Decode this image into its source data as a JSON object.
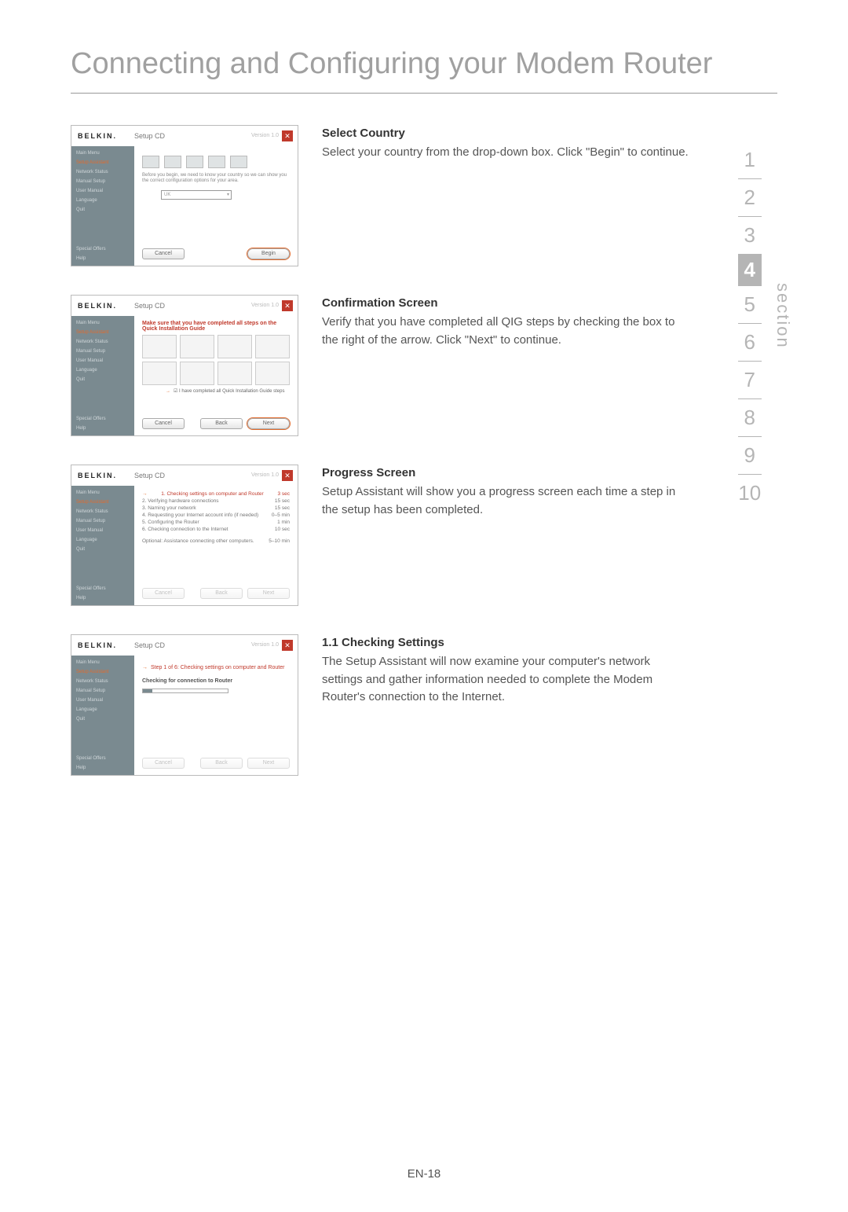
{
  "page_title": "Connecting and Configuring your Modem Router",
  "page_number": "EN-18",
  "nav": {
    "label": "section",
    "items": [
      "1",
      "2",
      "3",
      "4",
      "5",
      "6",
      "7",
      "8",
      "9",
      "10"
    ],
    "active": "4"
  },
  "shot_common": {
    "logo": "BELKIN.",
    "title": "Setup CD",
    "version": "Version 1.0",
    "close": "✕",
    "menu": {
      "main": "Main Menu",
      "setup": "Setup Assistant",
      "status": "Network Status",
      "manual": "Manual Setup",
      "user_manual": "User Manual",
      "language": "Language",
      "quit": "Quit",
      "offers": "Special Offers",
      "help": "Help"
    }
  },
  "sec1": {
    "heading": "Select Country",
    "body": "Select your country from the drop-down box. Click \"Begin\" to continue.",
    "hint": "Before you begin, we need to know your country so we can show you the correct configuration options for your area.",
    "dropdown": "UK",
    "cancel": "Cancel",
    "begin": "Begin"
  },
  "sec2": {
    "heading": "Confirmation Screen",
    "body": "Verify that you have completed all QIG steps by checking the box to the right of the arrow. Click \"Next\" to continue.",
    "banner": "Make sure that you have completed all steps on the Quick Installation Guide",
    "check": "I have completed all Quick Installation Guide steps",
    "cancel": "Cancel",
    "back": "Back",
    "next": "Next"
  },
  "sec3": {
    "heading": "Progress Screen",
    "body": "Setup Assistant will show you a progress screen each time a step in the setup has been completed.",
    "rows": [
      {
        "t": "1. Checking settings on computer and Router",
        "d": "3 sec"
      },
      {
        "t": "2. Verifying hardware connections",
        "d": "15 sec"
      },
      {
        "t": "3. Naming your network",
        "d": "15 sec"
      },
      {
        "t": "4. Requesting your Internet account info (if needed)",
        "d": "0–5 min"
      },
      {
        "t": "5. Configuring the Router",
        "d": "1 min"
      },
      {
        "t": "6. Checking connection to the Internet",
        "d": "10 sec"
      }
    ],
    "opt": {
      "t": "Optional: Assistance connecting other computers.",
      "d": "5–10 min"
    },
    "cancel": "Cancel",
    "back": "Back",
    "next": "Next"
  },
  "sec4": {
    "heading": "1.1  Checking Settings",
    "body": "The Setup Assistant will now examine your computer's network settings and gather information needed to complete the Modem Router's connection to the Internet.",
    "step": "Step 1 of 6: Checking settings on computer and Router",
    "sub": "Checking for connection to Router",
    "cancel": "Cancel",
    "back": "Back",
    "next": "Next"
  }
}
